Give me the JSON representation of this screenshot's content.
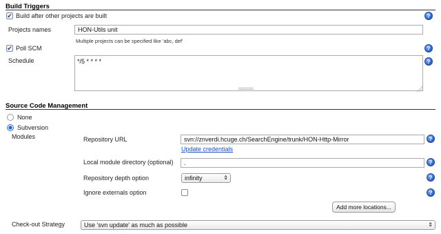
{
  "build_triggers": {
    "title": "Build Triggers",
    "build_after": {
      "label": "Build after other projects are built",
      "checked": true
    },
    "projects_names": {
      "label": "Projects names",
      "value": "HON-Utils unit",
      "hint": "Multiple projects can be specified like 'abc, def'"
    },
    "poll_scm": {
      "label": "Poll SCM",
      "checked": true
    },
    "schedule": {
      "label": "Schedule",
      "value": "*/5 * * * *"
    }
  },
  "scm": {
    "title": "Source Code Management",
    "options": [
      {
        "label": "None",
        "selected": false
      },
      {
        "label": "Subversion",
        "selected": true
      }
    ],
    "modules_label": "Modules",
    "repository_url": {
      "label": "Repository URL",
      "value": "svn://znverdi.hcuge.ch/SearchEngine/trunk/HON-Http-Mirror",
      "link": "Update credentials"
    },
    "local_module": {
      "label": "Local module directory (optional)",
      "value": "."
    },
    "depth": {
      "label": "Repository depth option",
      "value": "infinity"
    },
    "ignore_externals": {
      "label": "Ignore externals option",
      "checked": false
    },
    "add_more": "Add more locations...",
    "checkout": {
      "label": "Check-out Strategy",
      "value": "Use 'svn update' as much as possible"
    }
  },
  "icons": {
    "help": "?",
    "check": "✔",
    "select_arrow": "⇕"
  },
  "colors": {
    "link": "#1a4fc4",
    "help_icon": "#2a5fc7"
  }
}
